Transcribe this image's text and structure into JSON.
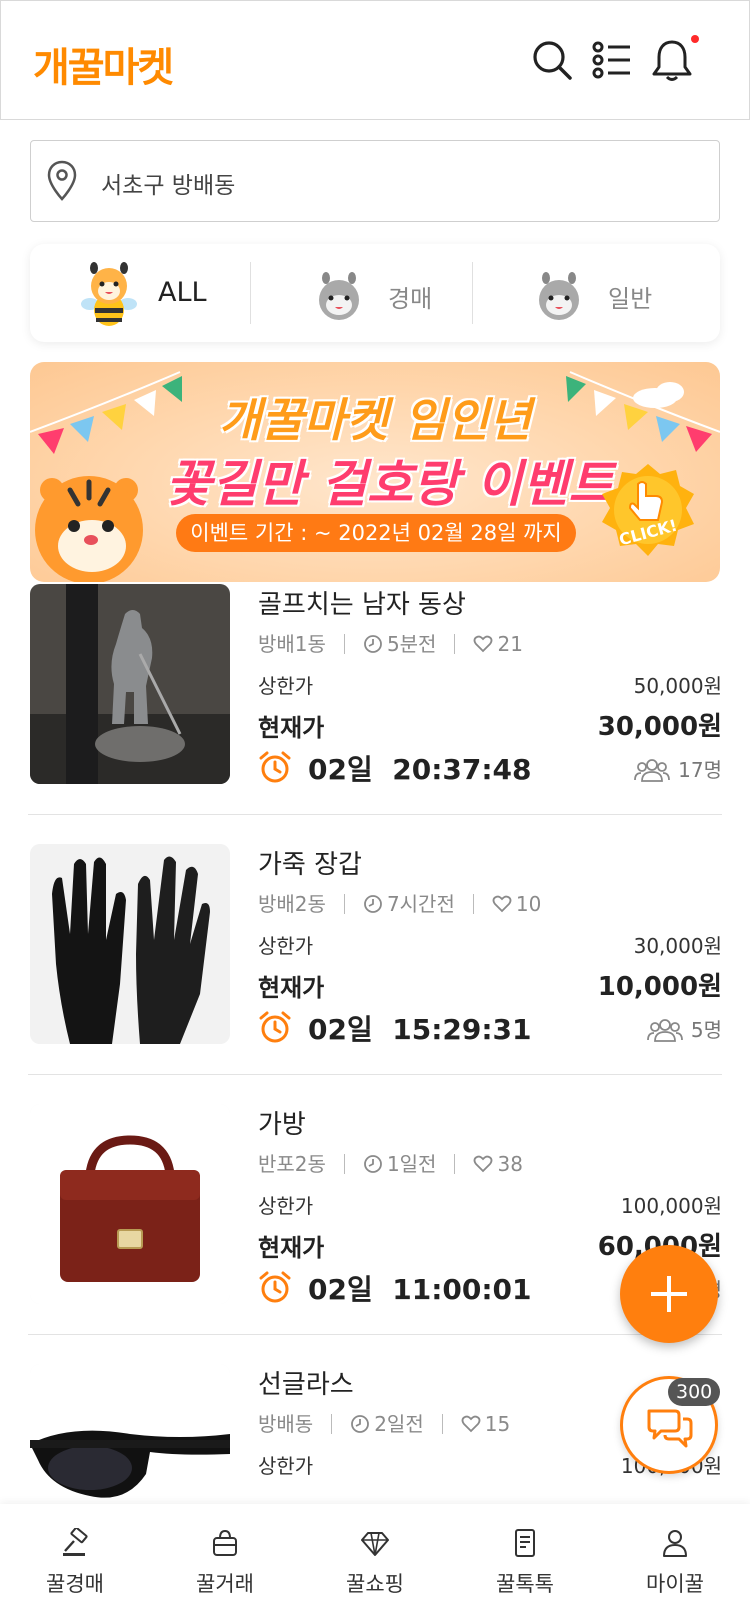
{
  "header": {
    "logo": "개꿀마켓",
    "icons": [
      "search-icon",
      "menu-list-icon",
      "bell-icon"
    ],
    "has_notification": true
  },
  "location": {
    "value": "서초구 방배동",
    "icon": "map-pin-icon"
  },
  "categories": [
    {
      "label": "ALL",
      "active": true
    },
    {
      "label": "경매",
      "active": false
    },
    {
      "label": "일반",
      "active": false
    }
  ],
  "banner": {
    "title1": "개꿀마켓 임인년",
    "title2": "꽃길만 걸호랑 이벤트",
    "period": "이벤트 기간 : ~ 2022년 02월 28일 까지",
    "cta": "CLICK!"
  },
  "labels": {
    "upper_price": "상한가",
    "current_price": "현재가"
  },
  "items": [
    {
      "title": "골프치는 남자 동상",
      "area": "방배1동",
      "time_ago": "5분전",
      "likes": "21",
      "upper_price": "50,000원",
      "current_price": "30,000원",
      "timer_days": "02일",
      "timer_time": "20:37:48",
      "bidders": "17명"
    },
    {
      "title": "가죽 장갑",
      "area": "방배2동",
      "time_ago": "7시간전",
      "likes": "10",
      "upper_price": "30,000원",
      "current_price": "10,000원",
      "timer_days": "02일",
      "timer_time": "15:29:31",
      "bidders": "5명"
    },
    {
      "title": "가방",
      "area": "반포2동",
      "time_ago": "1일전",
      "likes": "38",
      "upper_price": "100,000원",
      "current_price": "60,000원",
      "timer_days": "02일",
      "timer_time": "11:00:01",
      "bidders": "8명"
    },
    {
      "title": "선글라스",
      "area": "방배동",
      "time_ago": "2일전",
      "likes": "15",
      "upper_price": "100,000원"
    }
  ],
  "fab": {
    "add_icon": "plus-icon",
    "chat_icon": "chat-bubbles-icon",
    "chat_count": "300"
  },
  "bottom_nav": [
    {
      "label": "꿀경매",
      "icon": "gavel-icon"
    },
    {
      "label": "꿀거래",
      "icon": "bag-icon"
    },
    {
      "label": "꿀쇼핑",
      "icon": "diamond-icon"
    },
    {
      "label": "꿀톡톡",
      "icon": "document-icon"
    },
    {
      "label": "마이꿀",
      "icon": "user-icon"
    }
  ],
  "colors": {
    "brand": "#ff8a00",
    "accent_orange": "#ff7f0e",
    "notification": "#ff2a2a",
    "banner_pink": "#ff3d6e"
  }
}
